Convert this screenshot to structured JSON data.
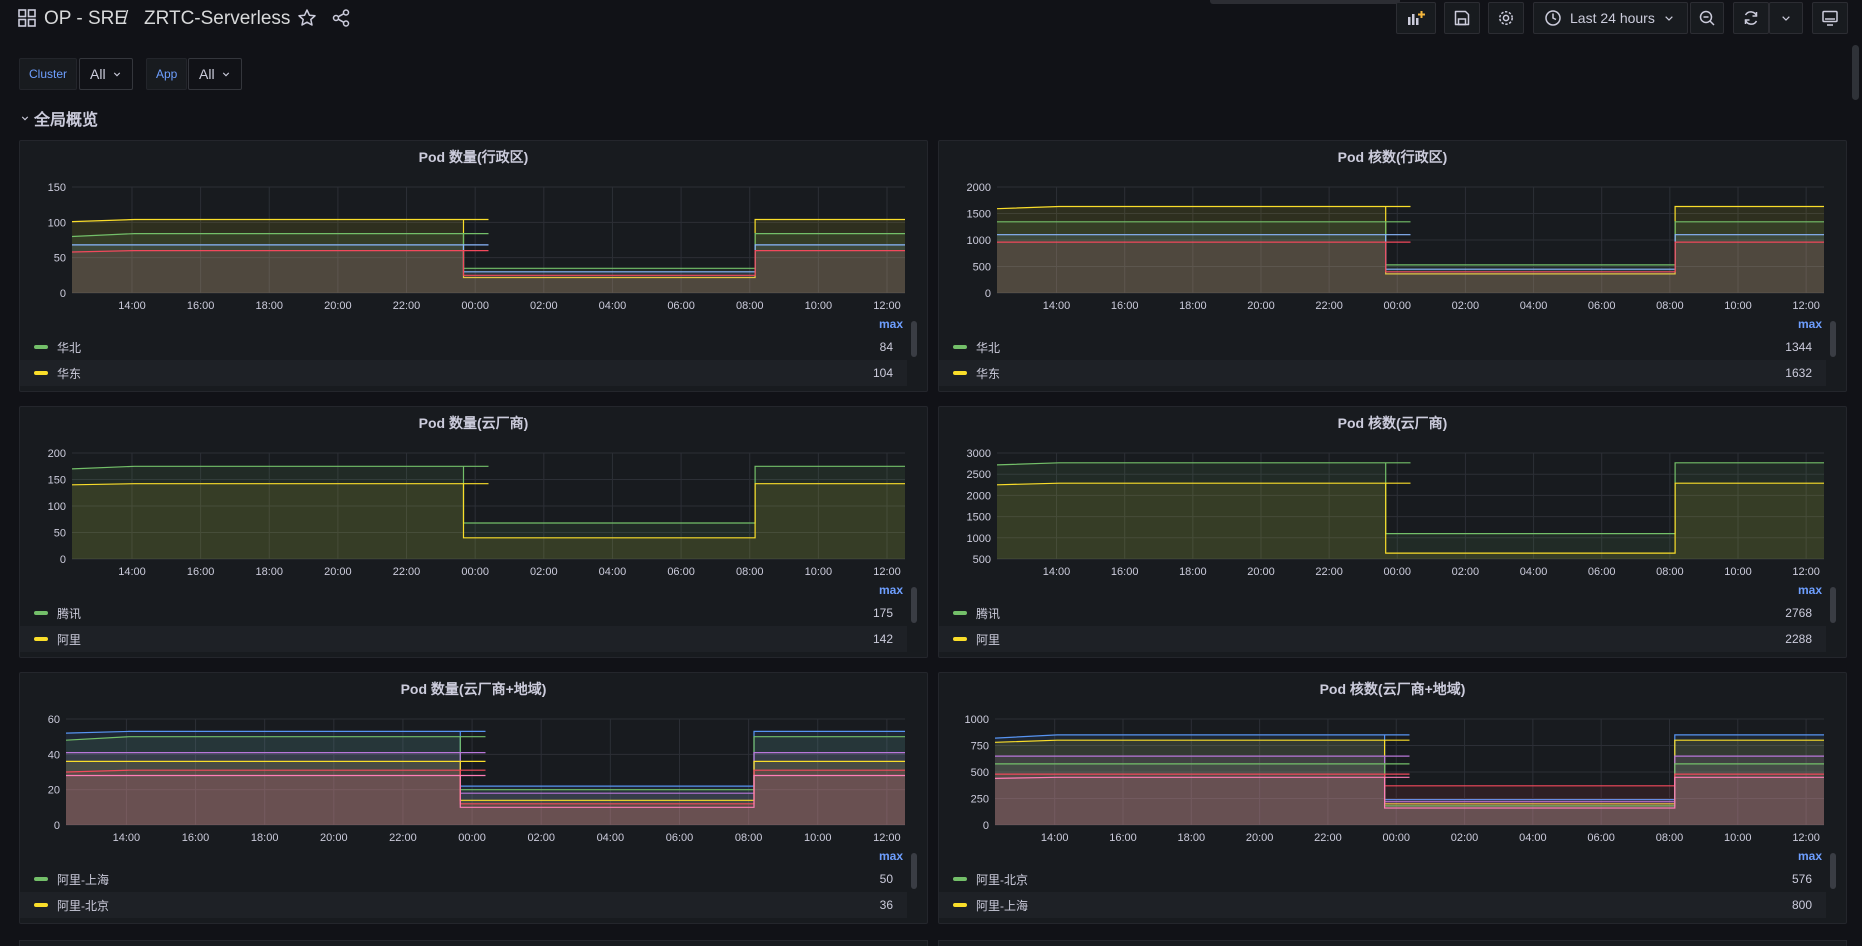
{
  "header": {
    "breadcrumb_folder": "OP - SRE",
    "breadcrumb_sep": "/",
    "dashboard_title": "ZRTC-Serverless",
    "time_range": "Last 24 hours"
  },
  "variables": [
    {
      "label": "Cluster",
      "value": "All"
    },
    {
      "label": "App",
      "value": "All"
    }
  ],
  "row": {
    "title": "全局概览"
  },
  "colors": {
    "green": "#73bf69",
    "yellow": "#fade2a",
    "blue": "#5794f2",
    "cyan": "#8ab8ff",
    "red": "#f2495c",
    "orange": "#ff9830",
    "purple": "#b877d9",
    "pink": "#ff7eb6"
  },
  "x_ticks": [
    "14:00",
    "16:00",
    "18:00",
    "20:00",
    "22:00",
    "00:00",
    "02:00",
    "04:00",
    "06:00",
    "08:00",
    "10:00",
    "12:00"
  ],
  "panels": [
    {
      "title": "Pod 数量(行政区)",
      "legend_header": "max",
      "legend": [
        {
          "name": "华北",
          "value": "84",
          "color": "green"
        },
        {
          "name": "华东",
          "value": "104",
          "color": "yellow"
        }
      ],
      "chart_data": {
        "type": "area",
        "y_ticks": [
          "0",
          "50",
          "100",
          "150"
        ],
        "ylim": [
          0,
          150
        ],
        "series": [
          {
            "color": "yellow",
            "values": [
              101,
              104,
              104,
              104,
              22,
              22,
              104,
              104
            ]
          },
          {
            "color": "green",
            "values": [
              80,
              84,
              84,
              84,
              35,
              35,
              84,
              84
            ]
          },
          {
            "color": "cyan",
            "values": [
              68,
              68,
              68,
              68,
              30,
              30,
              68,
              68
            ]
          },
          {
            "color": "red",
            "values": [
              58,
              60,
              60,
              60,
              25,
              25,
              60,
              60
            ]
          }
        ]
      }
    },
    {
      "title": "Pod 核数(行政区)",
      "legend_header": "max",
      "legend": [
        {
          "name": "华北",
          "value": "1344",
          "color": "green"
        },
        {
          "name": "华东",
          "value": "1632",
          "color": "yellow"
        }
      ],
      "chart_data": {
        "type": "area",
        "y_ticks": [
          "0",
          "500",
          "1000",
          "1500",
          "2000"
        ],
        "ylim": [
          0,
          2000
        ],
        "series": [
          {
            "color": "yellow",
            "values": [
              1590,
              1632,
              1632,
              1632,
              360,
              360,
              1632,
              1632
            ]
          },
          {
            "color": "green",
            "values": [
              1344,
              1344,
              1344,
              1344,
              530,
              530,
              1344,
              1344
            ]
          },
          {
            "color": "cyan",
            "values": [
              1100,
              1100,
              1100,
              1100,
              450,
              450,
              1100,
              1100
            ]
          },
          {
            "color": "red",
            "values": [
              960,
              960,
              960,
              960,
              400,
              400,
              960,
              960
            ]
          }
        ]
      }
    },
    {
      "title": "Pod 数量(云厂商)",
      "legend_header": "max",
      "legend": [
        {
          "name": "腾讯",
          "value": "175",
          "color": "green"
        },
        {
          "name": "阿里",
          "value": "142",
          "color": "yellow"
        }
      ],
      "chart_data": {
        "type": "area",
        "y_ticks": [
          "0",
          "50",
          "100",
          "150",
          "200"
        ],
        "ylim": [
          0,
          200
        ],
        "series": [
          {
            "color": "green",
            "values": [
              170,
              175,
              175,
              175,
              68,
              68,
              175,
              175
            ]
          },
          {
            "color": "yellow",
            "values": [
              140,
              142,
              142,
              142,
              40,
              40,
              142,
              142
            ]
          }
        ]
      }
    },
    {
      "title": "Pod 核数(云厂商)",
      "legend_header": "max",
      "legend": [
        {
          "name": "腾讯",
          "value": "2768",
          "color": "green"
        },
        {
          "name": "阿里",
          "value": "2288",
          "color": "yellow"
        }
      ],
      "chart_data": {
        "type": "area",
        "y_ticks": [
          "500",
          "1000",
          "1500",
          "2000",
          "2500",
          "3000"
        ],
        "ylim": [
          500,
          3000
        ],
        "series": [
          {
            "color": "green",
            "values": [
              2720,
              2768,
              2768,
              2768,
              1100,
              1100,
              2768,
              2768
            ]
          },
          {
            "color": "yellow",
            "values": [
              2250,
              2288,
              2288,
              2288,
              640,
              640,
              2288,
              2288
            ]
          }
        ]
      }
    },
    {
      "title": "Pod 数量(云厂商+地域)",
      "legend_header": "max",
      "legend": [
        {
          "name": "阿里-上海",
          "value": "50",
          "color": "green"
        },
        {
          "name": "阿里-北京",
          "value": "36",
          "color": "yellow"
        }
      ],
      "chart_data": {
        "type": "area",
        "y_ticks": [
          "0",
          "20",
          "40",
          "60"
        ],
        "ylim": [
          0,
          60
        ],
        "series": [
          {
            "color": "blue",
            "values": [
              52,
              53,
              53,
              53,
              22,
              22,
              53,
              53
            ]
          },
          {
            "color": "green",
            "values": [
              48,
              50,
              50,
              50,
              20,
              20,
              50,
              50
            ]
          },
          {
            "color": "purple",
            "values": [
              41,
              41,
              41,
              41,
              18,
              18,
              41,
              41
            ]
          },
          {
            "color": "yellow",
            "values": [
              36,
              36,
              36,
              36,
              14,
              14,
              36,
              36
            ]
          },
          {
            "color": "red",
            "values": [
              30,
              31,
              31,
              31,
              12,
              12,
              31,
              31
            ]
          },
          {
            "color": "pink",
            "values": [
              28,
              28,
              28,
              28,
              10,
              10,
              28,
              28
            ]
          }
        ]
      }
    },
    {
      "title": "Pod 核数(云厂商+地域)",
      "legend_header": "max",
      "legend": [
        {
          "name": "阿里-北京",
          "value": "576",
          "color": "green"
        },
        {
          "name": "阿里-上海",
          "value": "800",
          "color": "yellow"
        }
      ],
      "chart_data": {
        "type": "area",
        "y_ticks": [
          "0",
          "250",
          "500",
          "750",
          "1000"
        ],
        "ylim": [
          0,
          1000
        ],
        "series": [
          {
            "color": "blue",
            "values": [
              820,
              850,
              850,
              850,
              240,
              240,
              850,
              850
            ]
          },
          {
            "color": "yellow",
            "values": [
              780,
              800,
              800,
              800,
              200,
              200,
              800,
              800
            ]
          },
          {
            "color": "purple",
            "values": [
              650,
              650,
              650,
              650,
              220,
              220,
              650,
              650
            ]
          },
          {
            "color": "green",
            "values": [
              576,
              576,
              576,
              576,
              180,
              180,
              576,
              576
            ]
          },
          {
            "color": "red",
            "values": [
              480,
              480,
              480,
              480,
              370,
              370,
              480,
              480
            ]
          },
          {
            "color": "pink",
            "values": [
              440,
              450,
              450,
              450,
              160,
              160,
              450,
              450
            ]
          }
        ]
      }
    }
  ]
}
